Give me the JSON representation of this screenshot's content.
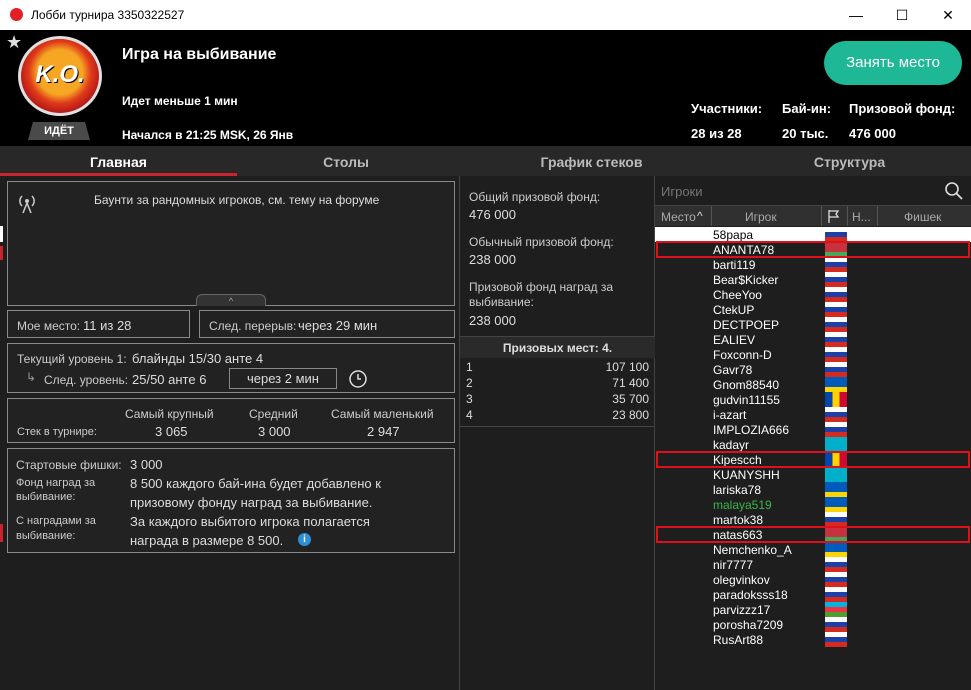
{
  "window": {
    "title": "Лобби турнира 3350322527",
    "min": "—",
    "max": "☐",
    "close": "✕"
  },
  "header": {
    "badge": "ИДЁТ",
    "logo_text": "K.O.",
    "title": "Игра на выбивание",
    "status": "Идет меньше 1 мин",
    "started": "Начался в 21:25 MSK, 26 Янв",
    "participants_label": "Участники:",
    "participants_value": "28 из 28",
    "buyin_label": "Бай-ин:",
    "buyin_value": "20 тыс.",
    "prize_label": "Призовой фонд:",
    "prize_value": "476 000",
    "seat_button": "Занять место"
  },
  "tabs": [
    "Главная",
    "Столы",
    "График стеков",
    "Структура"
  ],
  "info": {
    "announcement": "Баунти за рандомных игроков, см. тему на форуме",
    "my_place_label": "Мое место:",
    "my_place": "11 из 28",
    "next_break_label": "След. перерыв:",
    "next_break": "через 29 мин",
    "current_level_label": "Текущий уровень 1:",
    "current_blinds": "блайнды 15/30 анте  4",
    "next_level_label": "След. уровень:",
    "next_blinds": "25/50 анте  6",
    "next_in": "через 2 мин",
    "stack_label": "Стек в турнире:",
    "stack_headers": [
      "Самый крупный",
      "Средний",
      "Самый маленький"
    ],
    "stack_values": [
      "3 065",
      "3 000",
      "2 947"
    ],
    "chips_label": "Стартовые фишки:",
    "chips_value": "3 000",
    "ko_fund_label": "Фонд наград за выбивание:",
    "ko_fund_value": "8 500 каждого бай-ина будет добавлено к призовому фонду наград за выбивание.",
    "ko_reward_label": "С наградами за выбивание:",
    "ko_reward_value": "За каждого выбитого игрока полагается награда в размере 8 500.",
    "info_icon": "i"
  },
  "prizes": {
    "total_label": "Общий призовой фонд:",
    "total": "476 000",
    "regular_label": "Обычный призовой фонд:",
    "regular": "238 000",
    "ko_label": "Призовой фонд наград за выбивание:",
    "ko": "238 000",
    "places_label": "Призовых мест: 4.",
    "rows": [
      {
        "place": "1",
        "amount": "107 100"
      },
      {
        "place": "2",
        "amount": "71 400"
      },
      {
        "place": "3",
        "amount": "35 700"
      },
      {
        "place": "4",
        "amount": "23 800"
      }
    ]
  },
  "players": {
    "search_placeholder": "Игроки",
    "columns": [
      "Место",
      "Игрок",
      "Н...",
      "Фишек"
    ],
    "list": [
      {
        "name": "58papa",
        "flag": "ru",
        "color": "#ffffff"
      },
      {
        "name": "ANANTA78",
        "flag": "by",
        "color": "#ffffff"
      },
      {
        "name": "barti119",
        "flag": "ru",
        "color": "#ffffff"
      },
      {
        "name": "Bear$Kicker",
        "flag": "ru",
        "color": "#ffffff"
      },
      {
        "name": "CheeYoo",
        "flag": "ru",
        "color": "#ffffff"
      },
      {
        "name": "CtekUP",
        "flag": "ru",
        "color": "#ffffff"
      },
      {
        "name": "DECTPOEP",
        "flag": "ru",
        "color": "#ffffff"
      },
      {
        "name": "EALIEV",
        "flag": "ru",
        "color": "#ffffff"
      },
      {
        "name": "Foxconn-D",
        "flag": "ru",
        "color": "#ffffff"
      },
      {
        "name": "Gavr78",
        "flag": "ru",
        "color": "#ffffff"
      },
      {
        "name": "Gnom88540",
        "flag": "ua",
        "color": "#ffffff"
      },
      {
        "name": "gudvin11155",
        "flag": "md",
        "color": "#ffffff"
      },
      {
        "name": "i-azart",
        "flag": "ru",
        "color": "#ffffff"
      },
      {
        "name": "IMPLOZIA666",
        "flag": "ru",
        "color": "#ffffff"
      },
      {
        "name": "kadayr",
        "flag": "kz",
        "color": "#ffffff"
      },
      {
        "name": "Kipescch",
        "flag": "md",
        "color": "#ffffff"
      },
      {
        "name": "KUANYSHH",
        "flag": "kz",
        "color": "#ffffff"
      },
      {
        "name": "lariska78",
        "flag": "ua",
        "color": "#ffffff"
      },
      {
        "name": "malaya519",
        "flag": "ua",
        "color": "#3bb54a"
      },
      {
        "name": "martok38",
        "flag": "ru",
        "color": "#ffffff"
      },
      {
        "name": "natas663",
        "flag": "by",
        "color": "#ffffff"
      },
      {
        "name": "Nemchenko_A",
        "flag": "ua",
        "color": "#ffffff"
      },
      {
        "name": "nir7777",
        "flag": "ru",
        "color": "#ffffff"
      },
      {
        "name": "olegvinkov",
        "flag": "ru",
        "color": "#ffffff"
      },
      {
        "name": "paradoksss18",
        "flag": "ru",
        "color": "#ffffff"
      },
      {
        "name": "parvizzz17",
        "flag": "az",
        "color": "#ffffff"
      },
      {
        "name": "porosha7209",
        "flag": "ru",
        "color": "#ffffff"
      },
      {
        "name": "RusArt88",
        "flag": "ru",
        "color": "#ffffff"
      }
    ]
  },
  "highlight_color": "#e0101a",
  "accent": "#1fb896"
}
